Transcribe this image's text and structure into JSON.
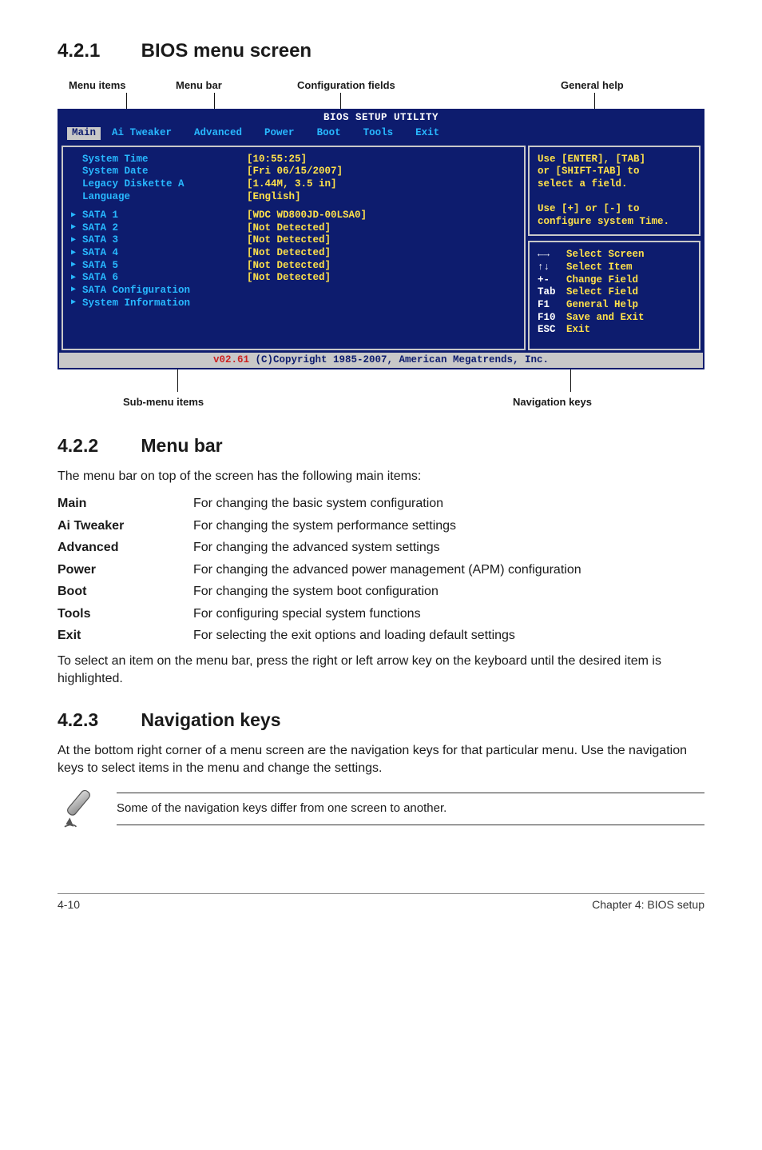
{
  "headings": {
    "s421_num": "4.2.1",
    "s421_title": "BIOS menu screen",
    "s422_num": "4.2.2",
    "s422_title": "Menu bar",
    "s423_num": "4.2.3",
    "s423_title": "Navigation keys"
  },
  "captions": {
    "menu_items": "Menu items",
    "menu_bar": "Menu bar",
    "config_fields": "Configuration fields",
    "general_help": "General help",
    "sub_menu": "Sub-menu items",
    "nav_keys": "Navigation keys"
  },
  "bios": {
    "title": "BIOS SETUP UTILITY",
    "tabs": [
      "Main",
      "Ai Tweaker",
      "Advanced",
      "Power",
      "Boot",
      "Tools",
      "Exit"
    ],
    "selected_tab": "Main",
    "rows": [
      {
        "label": "System Time",
        "value": "[10:55:25]",
        "tri": false
      },
      {
        "label": "System Date",
        "value": "[Fri 06/15/2007]",
        "tri": false
      },
      {
        "label": "Legacy Diskette A",
        "value": "[1.44M, 3.5 in]",
        "tri": false
      },
      {
        "label": "Language",
        "value": "[English]",
        "tri": false
      },
      {
        "label": "SATA 1",
        "value": "[WDC WD800JD-00LSA0]",
        "tri": true
      },
      {
        "label": "SATA 2",
        "value": "[Not Detected]",
        "tri": true
      },
      {
        "label": "SATA 3",
        "value": "[Not Detected]",
        "tri": true
      },
      {
        "label": "SATA 4",
        "value": "[Not Detected]",
        "tri": true
      },
      {
        "label": "SATA 5",
        "value": "[Not Detected]",
        "tri": true
      },
      {
        "label": "SATA 6",
        "value": "[Not Detected]",
        "tri": true
      },
      {
        "label": "SATA Configuration",
        "value": "",
        "tri": true
      },
      {
        "label": "System Information",
        "value": "",
        "tri": true
      }
    ],
    "help_top": [
      "Use [ENTER], [TAB]",
      "or [SHIFT-TAB] to",
      "select a field.",
      "",
      "Use [+] or [-] to",
      "configure system Time."
    ],
    "help_bot": [
      {
        "key": "←→",
        "label": "Select Screen"
      },
      {
        "key": "↑↓",
        "label": "Select Item"
      },
      {
        "key": "+-",
        "label": "Change Field"
      },
      {
        "key": "Tab",
        "label": "Select Field"
      },
      {
        "key": "F1",
        "label": "General Help"
      },
      {
        "key": "F10",
        "label": "Save and Exit"
      },
      {
        "key": "ESC",
        "label": "Exit"
      }
    ],
    "footer_ver": "v02.61",
    "footer_txt": " (C)Copyright 1985-2007, American Megatrends, Inc."
  },
  "body": {
    "s422_intro": "The menu bar on top of the screen has the following main items:",
    "defs": [
      {
        "term": "Main",
        "desc": "For changing the basic system configuration"
      },
      {
        "term": "Ai Tweaker",
        "desc": "For changing the system performance settings"
      },
      {
        "term": "Advanced",
        "desc": "For changing the advanced system settings"
      },
      {
        "term": "Power",
        "desc": "For changing the advanced power management (APM) configuration"
      },
      {
        "term": "Boot",
        "desc": "For changing the system boot configuration"
      },
      {
        "term": "Tools",
        "desc": "For configuring special system functions"
      },
      {
        "term": "Exit",
        "desc": "For selecting the exit options and loading default settings"
      }
    ],
    "s422_outro": "To select an item on the menu bar, press the right or left arrow key on the keyboard until the desired item is highlighted.",
    "s423_para": "At the bottom right corner of a menu screen are the navigation keys for that particular menu. Use the navigation keys to select items in the menu and change the settings.",
    "note": "Some of the navigation keys differ from one screen to another."
  },
  "footer": {
    "left": "4-10",
    "right": "Chapter 4: BIOS setup"
  }
}
